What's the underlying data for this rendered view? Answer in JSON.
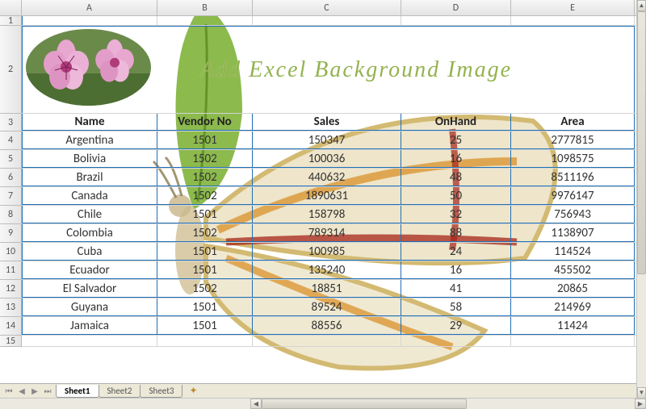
{
  "columns": [
    {
      "letter": "A",
      "width": 168
    },
    {
      "letter": "B",
      "width": 118
    },
    {
      "letter": "C",
      "width": 184
    },
    {
      "letter": "D",
      "width": 136
    },
    {
      "letter": "E",
      "width": 153
    }
  ],
  "title_text": "Add  Excel  Background  Image",
  "headers": {
    "name": "Name",
    "vendor": "Vendor No",
    "sales": "Sales",
    "onhand": "OnHand",
    "area": "Area"
  },
  "rows": [
    {
      "name": "Argentina",
      "vendor": "1501",
      "sales": "150347",
      "onhand": "25",
      "area": "2777815"
    },
    {
      "name": "Bolivia",
      "vendor": "1502",
      "sales": "100036",
      "onhand": "16",
      "area": "1098575"
    },
    {
      "name": "Brazil",
      "vendor": "1502",
      "sales": "440632",
      "onhand": "48",
      "area": "8511196"
    },
    {
      "name": "Canada",
      "vendor": "1502",
      "sales": "1890631",
      "onhand": "50",
      "area": "9976147"
    },
    {
      "name": "Chile",
      "vendor": "1501",
      "sales": "158798",
      "onhand": "32",
      "area": "756943"
    },
    {
      "name": "Colombia",
      "vendor": "1502",
      "sales": "789314",
      "onhand": "88",
      "area": "1138907"
    },
    {
      "name": "Cuba",
      "vendor": "1501",
      "sales": "100985",
      "onhand": "24",
      "area": "114524"
    },
    {
      "name": "Ecuador",
      "vendor": "1501",
      "sales": "135240",
      "onhand": "16",
      "area": "455502"
    },
    {
      "name": "El Salvador",
      "vendor": "1502",
      "sales": "18851",
      "onhand": "41",
      "area": "20865"
    },
    {
      "name": "Guyana",
      "vendor": "1501",
      "sales": "89524",
      "onhand": "58",
      "area": "214969"
    },
    {
      "name": "Jamaica",
      "vendor": "1501",
      "sales": "88556",
      "onhand": "29",
      "area": "11424"
    }
  ],
  "sheet_tabs": [
    "Sheet1",
    "Sheet2",
    "Sheet3"
  ],
  "active_tab": "Sheet1"
}
